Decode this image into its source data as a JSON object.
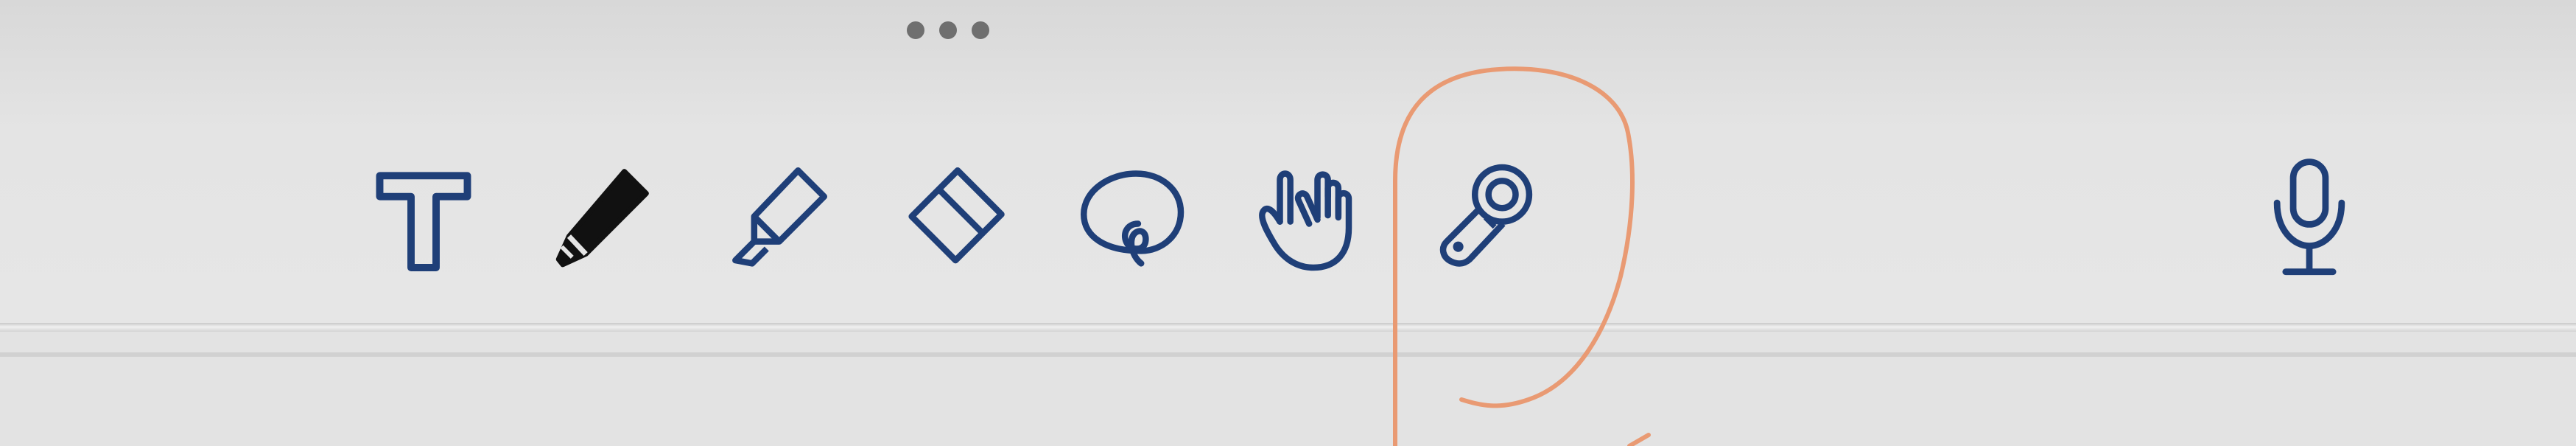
{
  "toolbar": {
    "more_label": "",
    "tools": [
      {
        "name": "text-tool",
        "icon": "text-t-icon"
      },
      {
        "name": "pen-tool",
        "icon": "pen-icon",
        "state": "selected"
      },
      {
        "name": "highlighter-tool",
        "icon": "highlighter-icon"
      },
      {
        "name": "eraser-tool",
        "icon": "eraser-icon"
      },
      {
        "name": "lasso-tool",
        "icon": "lasso-icon"
      },
      {
        "name": "hand-tool",
        "icon": "hand-icon"
      },
      {
        "name": "laser-pointer-tool",
        "icon": "laser-pointer-icon"
      }
    ],
    "mic": {
      "name": "microphone-button",
      "icon": "microphone-icon"
    }
  },
  "colors": {
    "icon_blue": "#1f3f78",
    "pen_fill": "#111111",
    "annotation": "#e99a73",
    "dots": "#6f6f6f",
    "background": "#e4e4e4"
  }
}
